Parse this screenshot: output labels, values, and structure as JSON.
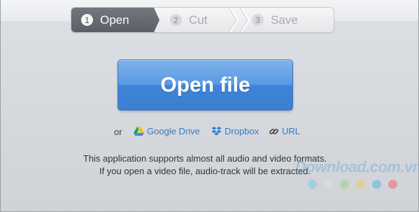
{
  "stepper": {
    "steps": [
      {
        "number": "1",
        "label": "Open",
        "state": "active"
      },
      {
        "number": "2",
        "label": "Cut",
        "state": "inactive"
      },
      {
        "number": "3",
        "label": "Save",
        "state": "inactive"
      }
    ]
  },
  "main": {
    "open_button_label": "Open file",
    "or_text": "or",
    "sources": [
      {
        "label": "Google Drive",
        "icon": "google-drive-icon"
      },
      {
        "label": "Dropbox",
        "icon": "dropbox-icon"
      },
      {
        "label": "URL",
        "icon": "link-icon"
      }
    ],
    "info_line1": "This application supports almost all audio and video formats.",
    "info_line2": "If you open a video file, audio-track will be extracted."
  },
  "watermark": {
    "text": "Download.com.vn",
    "dot_colors": [
      "#7ec6e8",
      "#d8dde2",
      "#9ed27f",
      "#f5c56a",
      "#5fb3e0",
      "#ef6b6b"
    ]
  },
  "colors": {
    "accent": "#4a8fdf",
    "link": "#3a79c7",
    "active_step": "#62666d"
  }
}
